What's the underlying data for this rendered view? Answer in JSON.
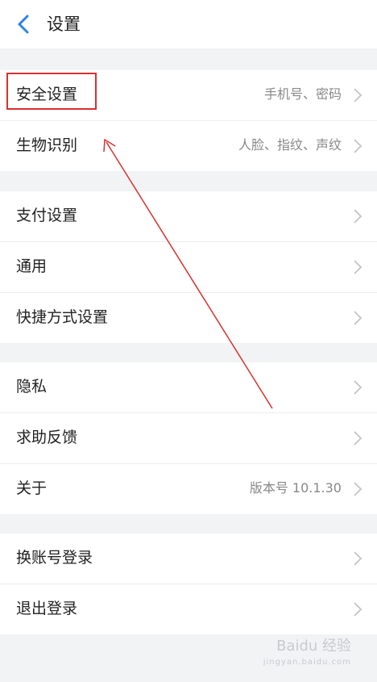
{
  "header": {
    "title": "设置"
  },
  "groups": [
    {
      "items": [
        {
          "label": "安全设置",
          "value": "手机号、密码"
        },
        {
          "label": "生物识别",
          "value": "人脸、指纹、声纹"
        }
      ]
    },
    {
      "items": [
        {
          "label": "支付设置",
          "value": ""
        },
        {
          "label": "通用",
          "value": ""
        },
        {
          "label": "快捷方式设置",
          "value": ""
        }
      ]
    },
    {
      "items": [
        {
          "label": "隐私",
          "value": ""
        },
        {
          "label": "求助反馈",
          "value": ""
        },
        {
          "label": "关于",
          "value": "版本号 10.1.30"
        }
      ]
    },
    {
      "items": [
        {
          "label": "换账号登录",
          "value": ""
        },
        {
          "label": "退出登录",
          "value": ""
        }
      ]
    }
  ],
  "watermark": {
    "text": "Baidu 经验",
    "sub": "jingyan.baidu.com"
  },
  "colors": {
    "accent": "#2b83e6",
    "highlight": "#d9312f"
  },
  "icons": {
    "back": "chevron-left-icon",
    "row": "chevron-right-icon"
  }
}
